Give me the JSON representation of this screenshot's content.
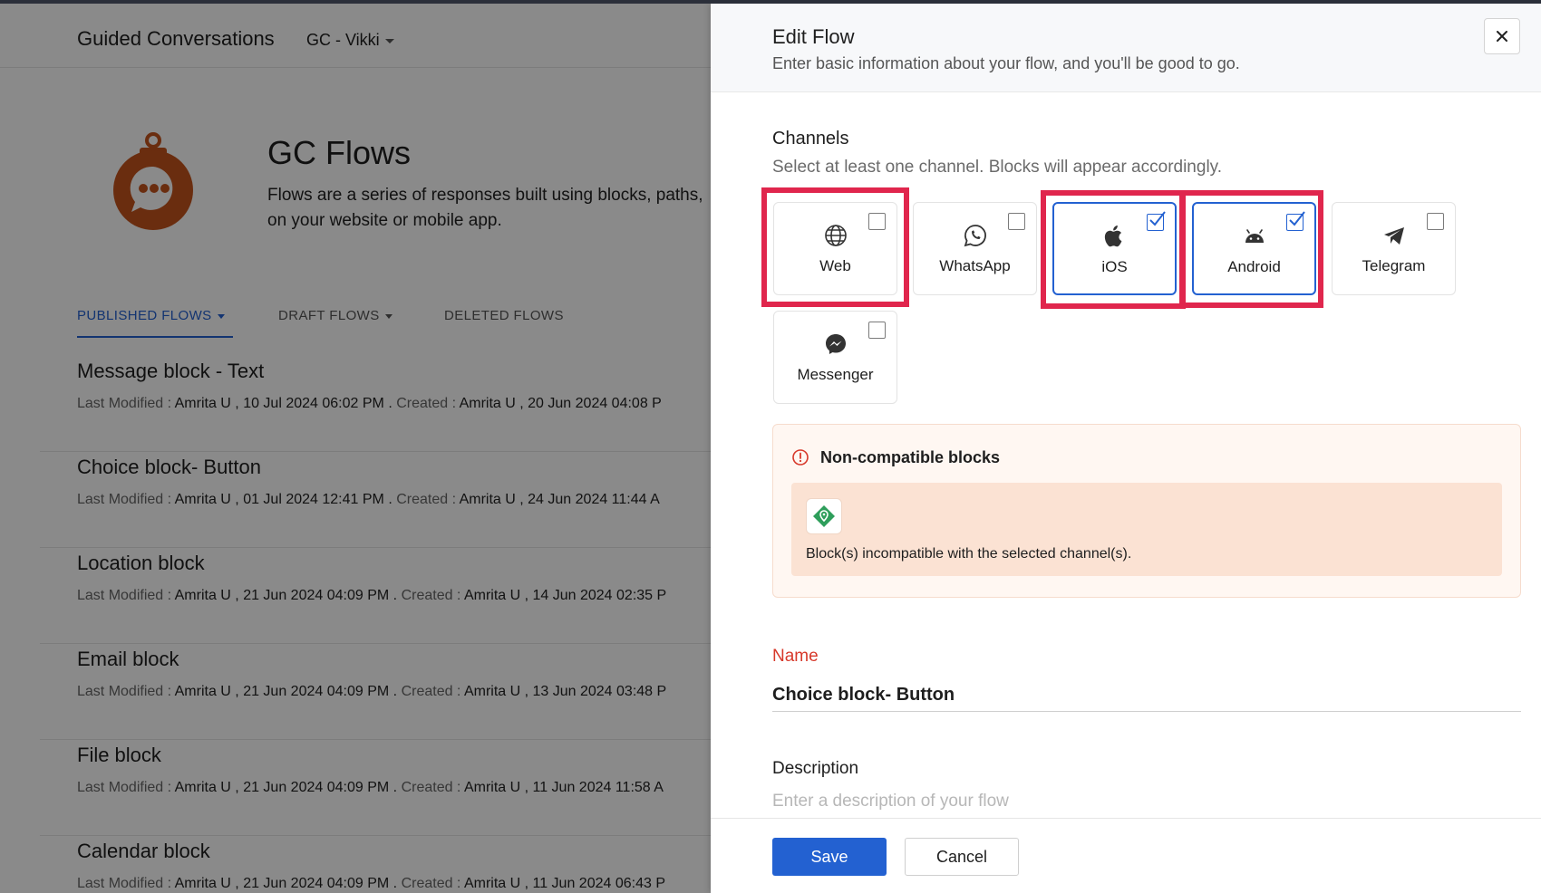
{
  "background": {
    "app_title": "Guided Conversations",
    "workspace": "GC - Vikki",
    "page_title": "GC Flows",
    "page_description": "Flows are a series of responses built using blocks, paths, on your website or mobile app.",
    "page_description_line1": "Flows are a series of responses built using blocks, paths,",
    "page_description_line2": "on your website or mobile app.",
    "tabs": [
      {
        "label": "PUBLISHED FLOWS",
        "active": true
      },
      {
        "label": "DRAFT FLOWS",
        "active": false
      },
      {
        "label": "DELETED FLOWS",
        "active": false
      }
    ],
    "meta_labels": {
      "last_modified": "Last Modified :",
      "created": "Created :",
      "separator": "."
    },
    "flows": [
      {
        "title": "Message block - Text",
        "modified": "Amrita U , 10 Jul 2024 06:02 PM",
        "created": "Amrita U , 20 Jun 2024 04:08 P"
      },
      {
        "title": "Choice block- Button",
        "modified": "Amrita U , 01 Jul 2024 12:41 PM",
        "created": "Amrita U , 24 Jun 2024 11:44 A"
      },
      {
        "title": "Location block",
        "modified": "Amrita U , 21 Jun 2024 04:09 PM",
        "created": "Amrita U , 14 Jun 2024 02:35 P"
      },
      {
        "title": "Email block",
        "modified": "Amrita U , 21 Jun 2024 04:09 PM",
        "created": "Amrita U , 13 Jun 2024 03:48 P"
      },
      {
        "title": "File block",
        "modified": "Amrita U , 21 Jun 2024 04:09 PM",
        "created": "Amrita U , 11 Jun 2024 11:58 A"
      },
      {
        "title": "Calendar block",
        "modified": "Amrita U , 21 Jun 2024 04:09 PM",
        "created": "Amrita U , 11 Jun 2024 06:43 P"
      }
    ]
  },
  "drawer": {
    "title": "Edit Flow",
    "subtitle": "Enter basic information about your flow, and you'll be good to go.",
    "close_icon": "close-icon",
    "channels_label": "Channels",
    "channels_hint": "Select at least one channel. Blocks will appear accordingly.",
    "channels": [
      {
        "label": "Web",
        "icon": "globe-icon",
        "checked": false,
        "highlighted": true
      },
      {
        "label": "WhatsApp",
        "icon": "whatsapp-icon",
        "checked": false,
        "highlighted": false
      },
      {
        "label": "iOS",
        "icon": "apple-icon",
        "checked": true,
        "highlighted": true
      },
      {
        "label": "Android",
        "icon": "android-icon",
        "checked": true,
        "highlighted": true
      },
      {
        "label": "Telegram",
        "icon": "telegram-icon",
        "checked": false,
        "highlighted": false
      },
      {
        "label": "Messenger",
        "icon": "messenger-icon",
        "checked": false,
        "highlighted": false
      }
    ],
    "warning": {
      "title": "Non-compatible blocks",
      "icon": "alert-circle-icon",
      "block_icon": "location-block-icon",
      "text": "Block(s) incompatible with the selected channel(s)."
    },
    "name_label": "Name",
    "name_value": "Choice block- Button",
    "description_label": "Description",
    "description_placeholder": "Enter a description of your flow",
    "save_label": "Save",
    "cancel_label": "Cancel"
  },
  "colors": {
    "accent": "#2361d1",
    "highlight": "#e0264d",
    "required": "#d7392b",
    "brand_orange": "#c5531d"
  }
}
